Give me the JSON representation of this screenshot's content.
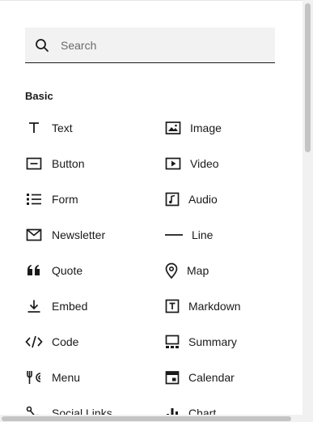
{
  "search": {
    "placeholder": "Search",
    "icon": "search-icon"
  },
  "section": {
    "title": "Basic"
  },
  "blocks": [
    {
      "label": "Text",
      "icon": "text-icon"
    },
    {
      "label": "Image",
      "icon": "image-icon"
    },
    {
      "label": "Button",
      "icon": "button-icon"
    },
    {
      "label": "Video",
      "icon": "video-icon"
    },
    {
      "label": "Form",
      "icon": "form-icon"
    },
    {
      "label": "Audio",
      "icon": "audio-icon"
    },
    {
      "label": "Newsletter",
      "icon": "newsletter-icon"
    },
    {
      "label": "Line",
      "icon": "line-icon"
    },
    {
      "label": "Quote",
      "icon": "quote-icon"
    },
    {
      "label": "Map",
      "icon": "map-icon"
    },
    {
      "label": "Embed",
      "icon": "embed-icon"
    },
    {
      "label": "Markdown",
      "icon": "markdown-icon"
    },
    {
      "label": "Code",
      "icon": "code-icon"
    },
    {
      "label": "Summary",
      "icon": "summary-icon"
    },
    {
      "label": "Menu",
      "icon": "menu-icon"
    },
    {
      "label": "Calendar",
      "icon": "calendar-icon"
    },
    {
      "label": "Social Links",
      "icon": "social-links-icon"
    },
    {
      "label": "Chart",
      "icon": "chart-icon"
    }
  ]
}
